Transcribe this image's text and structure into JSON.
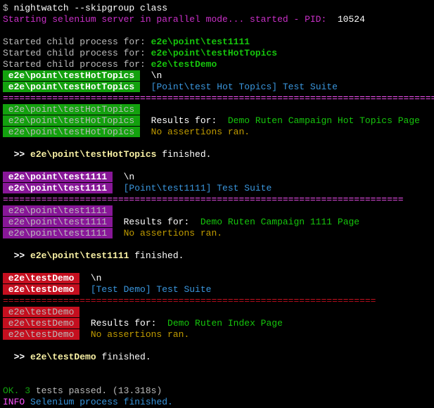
{
  "prompt": {
    "symbol": "$ ",
    "cmd": "nightwatch --skipgroup class"
  },
  "selenium": {
    "start": "Starting selenium server in parallel mode... started - PID:",
    "pid": "  10524"
  },
  "started": {
    "prefix": "Started child process for: ",
    "p1": "e2e\\point\\test1111",
    "p2": "e2e\\point\\testHotTopics",
    "p3": "e2e\\testDemo"
  },
  "hot": {
    "tag": " e2e\\point\\testHotTopics ",
    "nl": "  \\n",
    "suite": "  [Point\\test Hot Topics] Test Suite",
    "sep": "==================================================================================",
    "results_for": "  Results for:  ",
    "demo": "Demo Ruten Campaign Hot Topics Page",
    "noassert": "  No assertions ran.",
    "fin_pre": "  >> ",
    "fin_name": "e2e\\point\\testHotTopics",
    "fin_post": " finished."
  },
  "t1111": {
    "tag": " e2e\\point\\test1111 ",
    "nl": "  \\n",
    "suite": "  [Point\\test1111] Test Suite",
    "sep": "=========================================================================",
    "results_for": "  Results for:  ",
    "demo": "Demo Ruten Campaign 1111 Page",
    "noassert": "  No assertions ran.",
    "fin_pre": "  >> ",
    "fin_name": "e2e\\point\\test1111",
    "fin_post": " finished."
  },
  "demo": {
    "tag": " e2e\\testDemo ",
    "nl": "  \\n",
    "suite": "  [Test Demo] Test Suite",
    "sep": "====================================================================",
    "results_for": "  Results for:  ",
    "demo": "Demo Ruten Index Page",
    "noassert": "  No assertions ran.",
    "fin_pre": "  >> ",
    "fin_name": "e2e\\testDemo",
    "fin_post": " finished."
  },
  "summary": {
    "ok": "OK. 3",
    "passed": " tests passed. (13.318s)",
    "info": "INFO",
    "seldone": " Selenium process finished."
  }
}
